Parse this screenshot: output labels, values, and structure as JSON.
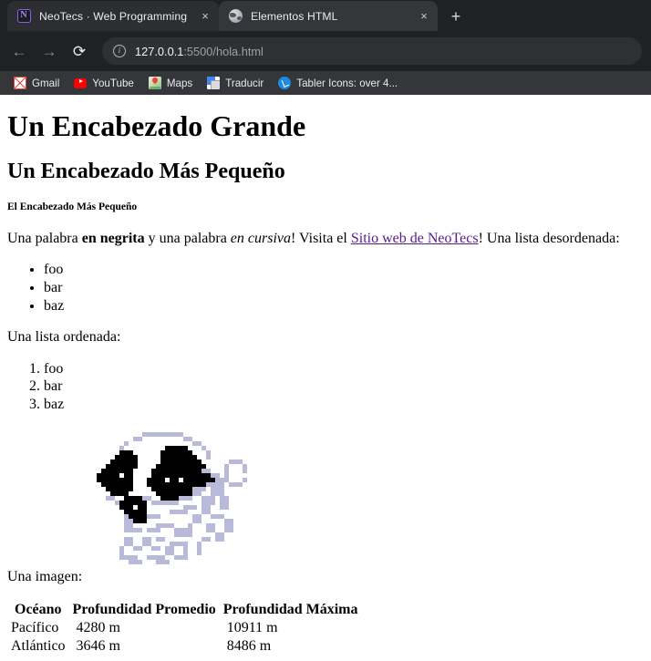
{
  "browser": {
    "tabs": [
      {
        "title": "NeoTecs · Web Programming",
        "favicon": "notion-icon",
        "active": false,
        "close_label": "×"
      },
      {
        "title": "Elementos HTML",
        "favicon": "globe-icon",
        "active": true,
        "close_label": "×"
      }
    ],
    "new_tab_label": "+",
    "nav": {
      "back_label": "←",
      "forward_label": "→",
      "reload_label": "⟳"
    },
    "omnibox": {
      "info_label": "i",
      "host": "127.0.0.1",
      "path": ":5500/hola.html"
    },
    "bookmarks": [
      {
        "label": "Gmail",
        "icon": "gmail-icon"
      },
      {
        "label": "YouTube",
        "icon": "youtube-icon"
      },
      {
        "label": "Maps",
        "icon": "maps-icon"
      },
      {
        "label": "Traducir",
        "icon": "translate-icon"
      },
      {
        "label": "Tabler Icons: over 4...",
        "icon": "tabler-icon"
      }
    ],
    "colors": {
      "tabstrip_bg": "#202124",
      "toolbar_bg": "#202124",
      "bookmarks_bg": "#35363a",
      "active_tab_bg": "#35363a",
      "inactive_tab_bg": "#2d2e31",
      "omnibox_bg": "#2f3033",
      "link_visited": "#551a8b"
    }
  },
  "page": {
    "h1": "Un Encabezado Grande",
    "h2": "Un Encabezado Más Pequeño",
    "h5": "El Encabezado Más Pequeño",
    "paragraph": {
      "part1": "Una palabra ",
      "bold": "en negrita",
      "part2": " y una palabra ",
      "italic": "en cursiva",
      "part3": "! Visita el ",
      "link": "Sitio web de NeoTecs",
      "part4": "! Una lista desordenada:"
    },
    "unordered_list": [
      "foo",
      "bar",
      "baz"
    ],
    "ordered_list_intro": "Una lista ordenada:",
    "ordered_list": [
      "foo",
      "bar",
      "baz"
    ],
    "image_alt": "dog-image",
    "image_caption": "Una imagen:",
    "table": {
      "headers": [
        "Océano",
        "Profundidad Promedio",
        "Profundidad Máxima"
      ],
      "rows": [
        [
          "Pacífico",
          "4280 m",
          "10911 m"
        ],
        [
          "Atlántico",
          "3646 m",
          "8486 m"
        ]
      ]
    }
  }
}
